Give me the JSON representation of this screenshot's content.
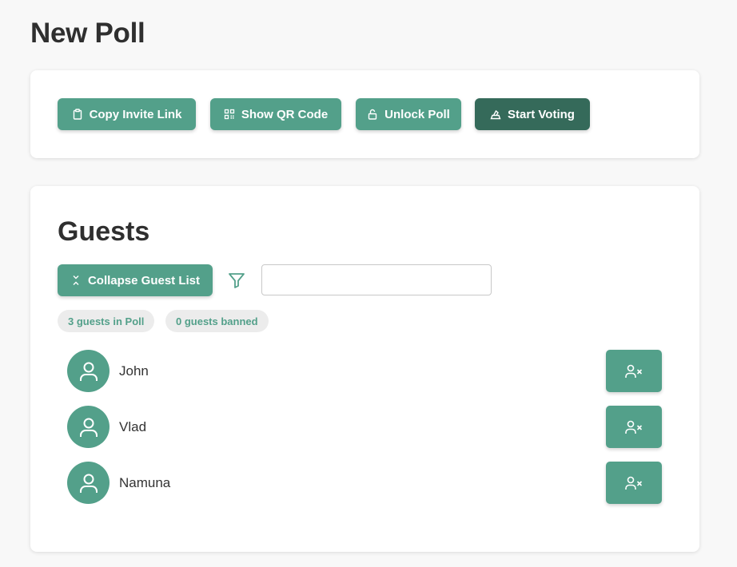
{
  "page": {
    "title": "New Poll"
  },
  "toolbar": {
    "copy_invite_label": "Copy Invite Link",
    "show_qr_label": "Show QR Code",
    "unlock_label": "Unlock Poll",
    "start_voting_label": "Start Voting"
  },
  "guests": {
    "title": "Guests",
    "collapse_label": "Collapse Guest List",
    "search_value": "",
    "in_poll_badge": "3 guests in Poll",
    "banned_badge": "0 guests banned",
    "list": [
      {
        "name": "John"
      },
      {
        "name": "Vlad"
      },
      {
        "name": "Namuna"
      }
    ]
  },
  "colors": {
    "primary": "#53a08a",
    "primary_dark": "#356a5a",
    "badge_bg": "#ececec",
    "page_bg": "#f8f8f8"
  },
  "icons": {
    "copy": "clipboard-icon",
    "qr": "qr-code-icon",
    "unlock": "unlock-icon",
    "start": "ballot-icon",
    "collapse": "collapse-arrows-icon",
    "filter": "filter-icon",
    "avatar": "user-icon",
    "ban": "user-x-icon"
  }
}
